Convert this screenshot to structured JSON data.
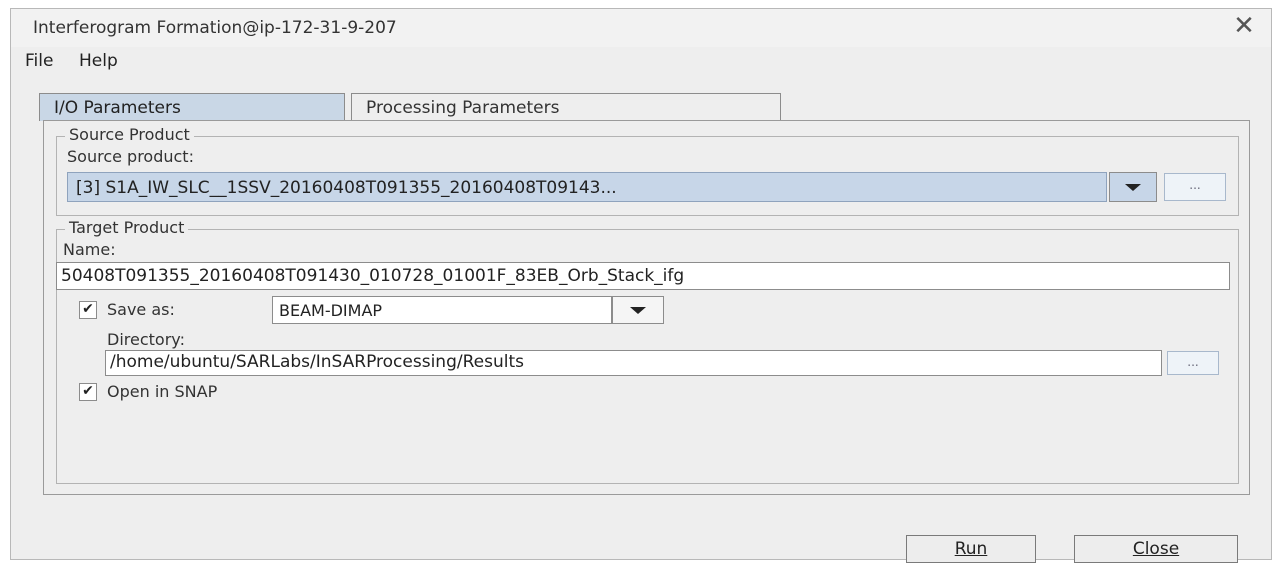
{
  "window": {
    "title": "Interferogram Formation@ip-172-31-9-207",
    "close_glyph": "✕"
  },
  "menu": [
    "File",
    "Help"
  ],
  "tabs": [
    {
      "label": "I/O Parameters",
      "active": true
    },
    {
      "label": "Processing Parameters",
      "active": false
    }
  ],
  "source": {
    "group_label": "Source Product",
    "field_label": "Source product:",
    "selected": "[3] S1A_IW_SLC__1SSV_20160408T091355_20160408T09143...",
    "browse_label": "..."
  },
  "target": {
    "group_label": "Target Product",
    "name_label": "Name:",
    "name_value": "50408T091355_20160408T091430_010728_01001F_83EB_Orb_Stack_ifg",
    "save_as_label": "Save as:",
    "save_as_checked": true,
    "format": "BEAM-DIMAP",
    "directory_label": "Directory:",
    "directory_value": "/home/ubuntu/SARLabs/InSARProcessing/Results",
    "browse_label": "...",
    "open_in_snap_label": "Open in SNAP",
    "open_in_snap_checked": true
  },
  "buttons": {
    "run": "Run",
    "close": "Close"
  },
  "icons": {
    "close": "close-icon",
    "dropdown": "chevron-down-icon",
    "checkmark": "checkmark-icon"
  },
  "colors": {
    "selection": "#c7d6e8",
    "active_tab": "#c9d7e6",
    "window_bg": "#eeeeee"
  }
}
